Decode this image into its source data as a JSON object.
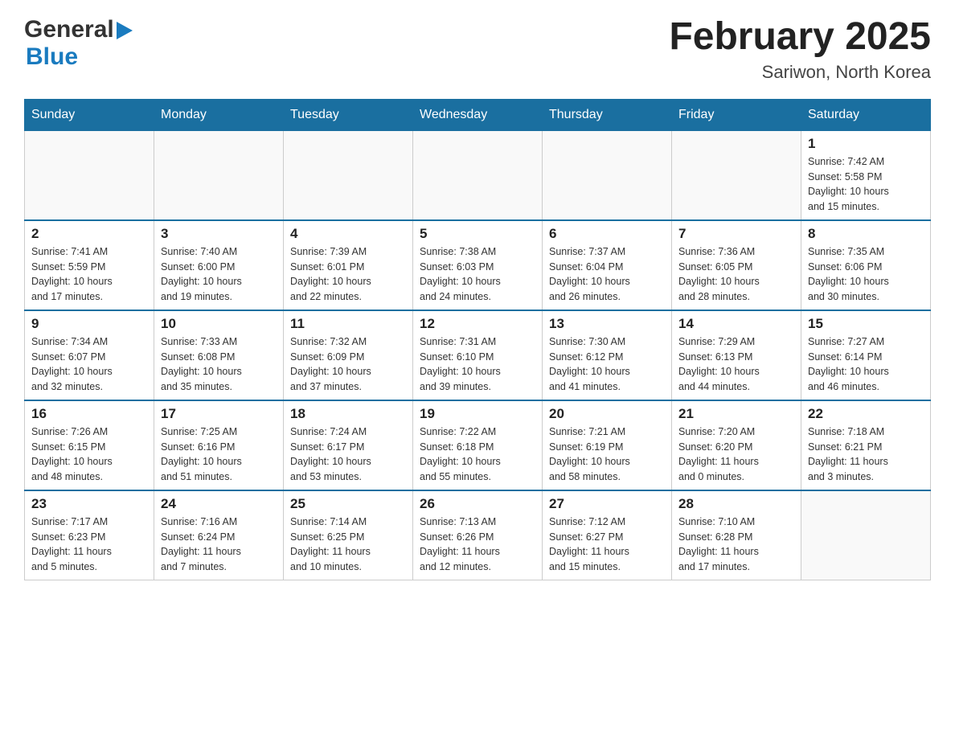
{
  "header": {
    "logo_general": "General",
    "logo_blue": "Blue",
    "month_title": "February 2025",
    "location": "Sariwon, North Korea"
  },
  "weekdays": [
    "Sunday",
    "Monday",
    "Tuesday",
    "Wednesday",
    "Thursday",
    "Friday",
    "Saturday"
  ],
  "weeks": [
    [
      {
        "day": "",
        "info": ""
      },
      {
        "day": "",
        "info": ""
      },
      {
        "day": "",
        "info": ""
      },
      {
        "day": "",
        "info": ""
      },
      {
        "day": "",
        "info": ""
      },
      {
        "day": "",
        "info": ""
      },
      {
        "day": "1",
        "info": "Sunrise: 7:42 AM\nSunset: 5:58 PM\nDaylight: 10 hours\nand 15 minutes."
      }
    ],
    [
      {
        "day": "2",
        "info": "Sunrise: 7:41 AM\nSunset: 5:59 PM\nDaylight: 10 hours\nand 17 minutes."
      },
      {
        "day": "3",
        "info": "Sunrise: 7:40 AM\nSunset: 6:00 PM\nDaylight: 10 hours\nand 19 minutes."
      },
      {
        "day": "4",
        "info": "Sunrise: 7:39 AM\nSunset: 6:01 PM\nDaylight: 10 hours\nand 22 minutes."
      },
      {
        "day": "5",
        "info": "Sunrise: 7:38 AM\nSunset: 6:03 PM\nDaylight: 10 hours\nand 24 minutes."
      },
      {
        "day": "6",
        "info": "Sunrise: 7:37 AM\nSunset: 6:04 PM\nDaylight: 10 hours\nand 26 minutes."
      },
      {
        "day": "7",
        "info": "Sunrise: 7:36 AM\nSunset: 6:05 PM\nDaylight: 10 hours\nand 28 minutes."
      },
      {
        "day": "8",
        "info": "Sunrise: 7:35 AM\nSunset: 6:06 PM\nDaylight: 10 hours\nand 30 minutes."
      }
    ],
    [
      {
        "day": "9",
        "info": "Sunrise: 7:34 AM\nSunset: 6:07 PM\nDaylight: 10 hours\nand 32 minutes."
      },
      {
        "day": "10",
        "info": "Sunrise: 7:33 AM\nSunset: 6:08 PM\nDaylight: 10 hours\nand 35 minutes."
      },
      {
        "day": "11",
        "info": "Sunrise: 7:32 AM\nSunset: 6:09 PM\nDaylight: 10 hours\nand 37 minutes."
      },
      {
        "day": "12",
        "info": "Sunrise: 7:31 AM\nSunset: 6:10 PM\nDaylight: 10 hours\nand 39 minutes."
      },
      {
        "day": "13",
        "info": "Sunrise: 7:30 AM\nSunset: 6:12 PM\nDaylight: 10 hours\nand 41 minutes."
      },
      {
        "day": "14",
        "info": "Sunrise: 7:29 AM\nSunset: 6:13 PM\nDaylight: 10 hours\nand 44 minutes."
      },
      {
        "day": "15",
        "info": "Sunrise: 7:27 AM\nSunset: 6:14 PM\nDaylight: 10 hours\nand 46 minutes."
      }
    ],
    [
      {
        "day": "16",
        "info": "Sunrise: 7:26 AM\nSunset: 6:15 PM\nDaylight: 10 hours\nand 48 minutes."
      },
      {
        "day": "17",
        "info": "Sunrise: 7:25 AM\nSunset: 6:16 PM\nDaylight: 10 hours\nand 51 minutes."
      },
      {
        "day": "18",
        "info": "Sunrise: 7:24 AM\nSunset: 6:17 PM\nDaylight: 10 hours\nand 53 minutes."
      },
      {
        "day": "19",
        "info": "Sunrise: 7:22 AM\nSunset: 6:18 PM\nDaylight: 10 hours\nand 55 minutes."
      },
      {
        "day": "20",
        "info": "Sunrise: 7:21 AM\nSunset: 6:19 PM\nDaylight: 10 hours\nand 58 minutes."
      },
      {
        "day": "21",
        "info": "Sunrise: 7:20 AM\nSunset: 6:20 PM\nDaylight: 11 hours\nand 0 minutes."
      },
      {
        "day": "22",
        "info": "Sunrise: 7:18 AM\nSunset: 6:21 PM\nDaylight: 11 hours\nand 3 minutes."
      }
    ],
    [
      {
        "day": "23",
        "info": "Sunrise: 7:17 AM\nSunset: 6:23 PM\nDaylight: 11 hours\nand 5 minutes."
      },
      {
        "day": "24",
        "info": "Sunrise: 7:16 AM\nSunset: 6:24 PM\nDaylight: 11 hours\nand 7 minutes."
      },
      {
        "day": "25",
        "info": "Sunrise: 7:14 AM\nSunset: 6:25 PM\nDaylight: 11 hours\nand 10 minutes."
      },
      {
        "day": "26",
        "info": "Sunrise: 7:13 AM\nSunset: 6:26 PM\nDaylight: 11 hours\nand 12 minutes."
      },
      {
        "day": "27",
        "info": "Sunrise: 7:12 AM\nSunset: 6:27 PM\nDaylight: 11 hours\nand 15 minutes."
      },
      {
        "day": "28",
        "info": "Sunrise: 7:10 AM\nSunset: 6:28 PM\nDaylight: 11 hours\nand 17 minutes."
      },
      {
        "day": "",
        "info": ""
      }
    ]
  ]
}
